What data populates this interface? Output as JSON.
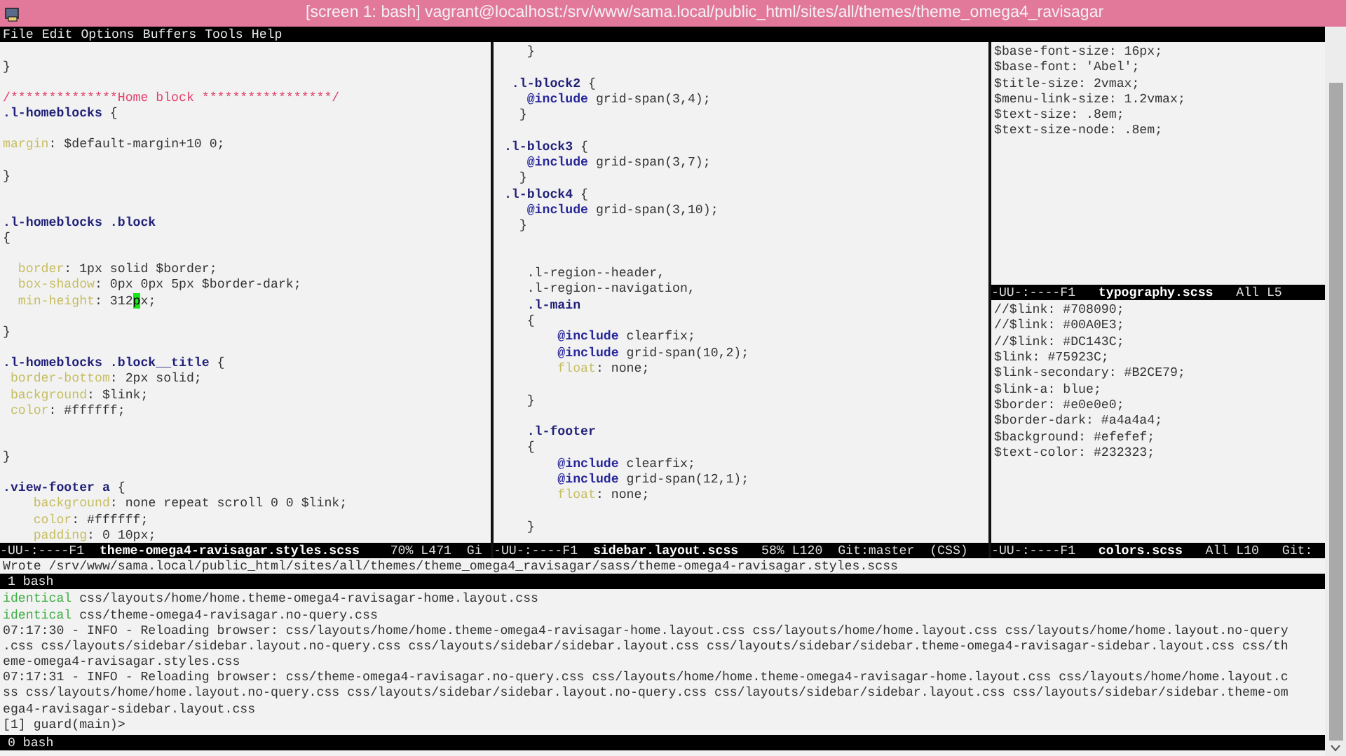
{
  "window": {
    "title": "[screen 1: bash] vagrant@localhost:/srv/www/sama.local/public_html/sites/all/themes/theme_omega4_ravisagar"
  },
  "menu": [
    "File",
    "Edit",
    "Options",
    "Buffers",
    "Tools",
    "Help"
  ],
  "panes": [
    {
      "windows": [
        {
          "lines": [
            {
              "kind": "blank"
            },
            {
              "kind": "code",
              "parts": [
                {
                  "text": "}",
                  "kind": "plain"
                }
              ]
            },
            {
              "kind": "blank"
            },
            {
              "kind": "code",
              "parts": [
                {
                  "text": "/**************Home block *****************/",
                  "kind": "comment"
                }
              ]
            },
            {
              "kind": "code",
              "parts": [
                {
                  "text": ".l-homeblocks",
                  "kind": "selector"
                },
                {
                  "text": " {",
                  "kind": "plain"
                }
              ]
            },
            {
              "kind": "blank"
            },
            {
              "kind": "code",
              "parts": [
                {
                  "text": "margin",
                  "kind": "property"
                },
                {
                  "text": ": $default-margin+10 0;",
                  "kind": "plain"
                }
              ]
            },
            {
              "kind": "blank"
            },
            {
              "kind": "code",
              "parts": [
                {
                  "text": "}",
                  "kind": "plain"
                }
              ]
            },
            {
              "kind": "blank"
            },
            {
              "kind": "blank"
            },
            {
              "kind": "code",
              "parts": [
                {
                  "text": ".l-homeblocks .block",
                  "kind": "selector"
                }
              ]
            },
            {
              "kind": "code",
              "parts": [
                {
                  "text": "{",
                  "kind": "plain"
                }
              ]
            },
            {
              "kind": "blank"
            },
            {
              "kind": "code",
              "parts": [
                {
                  "text": "  border",
                  "kind": "property"
                },
                {
                  "text": ": 1px solid $border;",
                  "kind": "plain"
                }
              ]
            },
            {
              "kind": "code",
              "parts": [
                {
                  "text": "  box-shadow",
                  "kind": "property"
                },
                {
                  "text": ": 0px 0px 5px $border-dark;",
                  "kind": "plain"
                }
              ]
            },
            {
              "kind": "code",
              "parts": [
                {
                  "text": "  min-height",
                  "kind": "property"
                },
                {
                  "text": ": 312",
                  "kind": "plain"
                },
                {
                  "text": "p",
                  "kind": "cursor"
                },
                {
                  "text": "x;",
                  "kind": "plain"
                }
              ]
            },
            {
              "kind": "blank"
            },
            {
              "kind": "code",
              "parts": [
                {
                  "text": "}",
                  "kind": "plain"
                }
              ]
            },
            {
              "kind": "blank"
            },
            {
              "kind": "code",
              "parts": [
                {
                  "text": ".l-homeblocks .block__title",
                  "kind": "selector"
                },
                {
                  "text": " {",
                  "kind": "plain"
                }
              ]
            },
            {
              "kind": "code",
              "parts": [
                {
                  "text": " border-bottom",
                  "kind": "property"
                },
                {
                  "text": ": 2px solid;",
                  "kind": "plain"
                }
              ]
            },
            {
              "kind": "code",
              "parts": [
                {
                  "text": " background",
                  "kind": "property"
                },
                {
                  "text": ": $link;",
                  "kind": "plain"
                }
              ]
            },
            {
              "kind": "code",
              "parts": [
                {
                  "text": " color",
                  "kind": "property"
                },
                {
                  "text": ": #ffffff;",
                  "kind": "plain"
                }
              ]
            },
            {
              "kind": "blank"
            },
            {
              "kind": "blank"
            },
            {
              "kind": "code",
              "parts": [
                {
                  "text": "}",
                  "kind": "plain"
                }
              ]
            },
            {
              "kind": "blank"
            },
            {
              "kind": "code",
              "parts": [
                {
                  "text": ".view-footer a",
                  "kind": "selector"
                },
                {
                  "text": " {",
                  "kind": "plain"
                }
              ]
            },
            {
              "kind": "code",
              "parts": [
                {
                  "text": "    background",
                  "kind": "property"
                },
                {
                  "text": ": none repeat scroll 0 0 $link;",
                  "kind": "plain"
                }
              ]
            },
            {
              "kind": "code",
              "parts": [
                {
                  "text": "    color",
                  "kind": "property"
                },
                {
                  "text": ": #ffffff;",
                  "kind": "plain"
                }
              ]
            },
            {
              "kind": "code",
              "parts": [
                {
                  "text": "    padding",
                  "kind": "property"
                },
                {
                  "text": ": 0 10px;",
                  "kind": "plain"
                }
              ]
            }
          ],
          "mode_line": [
            {
              "text": "-UU-:----F1  ",
              "kind": "plain"
            },
            {
              "text": "theme-omega4-ravisagar.styles.scss",
              "kind": "bold"
            },
            {
              "text": "    70% L471  Gi",
              "kind": "plain"
            }
          ]
        }
      ]
    },
    {
      "windows": [
        {
          "lines": [
            {
              "kind": "code",
              "parts": [
                {
                  "text": "    }",
                  "kind": "plain"
                }
              ]
            },
            {
              "kind": "blank"
            },
            {
              "kind": "code",
              "parts": [
                {
                  "text": "  .l-block2",
                  "kind": "selector"
                },
                {
                  "text": " {",
                  "kind": "plain"
                }
              ]
            },
            {
              "kind": "code",
              "parts": [
                {
                  "text": "    @include",
                  "kind": "keyword"
                },
                {
                  "text": " grid-span(3,4);",
                  "kind": "plain"
                }
              ]
            },
            {
              "kind": "code",
              "parts": [
                {
                  "text": "   }",
                  "kind": "plain"
                }
              ]
            },
            {
              "kind": "blank"
            },
            {
              "kind": "code",
              "parts": [
                {
                  "text": " .l-block3",
                  "kind": "selector"
                },
                {
                  "text": " {",
                  "kind": "plain"
                }
              ]
            },
            {
              "kind": "code",
              "parts": [
                {
                  "text": "    @include",
                  "kind": "keyword"
                },
                {
                  "text": " grid-span(3,7);",
                  "kind": "plain"
                }
              ]
            },
            {
              "kind": "code",
              "parts": [
                {
                  "text": "   }",
                  "kind": "plain"
                }
              ]
            },
            {
              "kind": "code",
              "parts": [
                {
                  "text": " .l-block4",
                  "kind": "selector"
                },
                {
                  "text": " {",
                  "kind": "plain"
                }
              ]
            },
            {
              "kind": "code",
              "parts": [
                {
                  "text": "    @include",
                  "kind": "keyword"
                },
                {
                  "text": " grid-span(3,10);",
                  "kind": "plain"
                }
              ]
            },
            {
              "kind": "code",
              "parts": [
                {
                  "text": "   }",
                  "kind": "plain"
                }
              ]
            },
            {
              "kind": "blank"
            },
            {
              "kind": "blank"
            },
            {
              "kind": "code",
              "parts": [
                {
                  "text": "    .l-region--header,",
                  "kind": "plain"
                }
              ]
            },
            {
              "kind": "code",
              "parts": [
                {
                  "text": "    .l-region--navigation,",
                  "kind": "plain"
                }
              ]
            },
            {
              "kind": "code",
              "parts": [
                {
                  "text": "    .l-main",
                  "kind": "selector"
                }
              ]
            },
            {
              "kind": "code",
              "parts": [
                {
                  "text": "    {",
                  "kind": "plain"
                }
              ]
            },
            {
              "kind": "code",
              "parts": [
                {
                  "text": "        @include",
                  "kind": "keyword"
                },
                {
                  "text": " clearfix;",
                  "kind": "plain"
                }
              ]
            },
            {
              "kind": "code",
              "parts": [
                {
                  "text": "        @include",
                  "kind": "keyword"
                },
                {
                  "text": " grid-span(10,2);",
                  "kind": "plain"
                }
              ]
            },
            {
              "kind": "code",
              "parts": [
                {
                  "text": "        float",
                  "kind": "property"
                },
                {
                  "text": ": none;",
                  "kind": "plain"
                }
              ]
            },
            {
              "kind": "blank"
            },
            {
              "kind": "code",
              "parts": [
                {
                  "text": "    }",
                  "kind": "plain"
                }
              ]
            },
            {
              "kind": "blank"
            },
            {
              "kind": "code",
              "parts": [
                {
                  "text": "    .l-footer",
                  "kind": "selector"
                }
              ]
            },
            {
              "kind": "code",
              "parts": [
                {
                  "text": "    {",
                  "kind": "plain"
                }
              ]
            },
            {
              "kind": "code",
              "parts": [
                {
                  "text": "        @include",
                  "kind": "keyword"
                },
                {
                  "text": " clearfix;",
                  "kind": "plain"
                }
              ]
            },
            {
              "kind": "code",
              "parts": [
                {
                  "text": "        @include",
                  "kind": "keyword"
                },
                {
                  "text": " grid-span(12,1);",
                  "kind": "plain"
                }
              ]
            },
            {
              "kind": "code",
              "parts": [
                {
                  "text": "        float",
                  "kind": "property"
                },
                {
                  "text": ": none;",
                  "kind": "plain"
                }
              ]
            },
            {
              "kind": "blank"
            },
            {
              "kind": "code",
              "parts": [
                {
                  "text": "    }",
                  "kind": "plain"
                }
              ]
            }
          ],
          "mode_line": [
            {
              "text": "-UU-:----F1  ",
              "kind": "plain"
            },
            {
              "text": "sidebar.layout.scss",
              "kind": "bold"
            },
            {
              "text": "   58% L120  Git:master  (CSS)",
              "kind": "plain"
            }
          ]
        }
      ]
    },
    {
      "windows": [
        {
          "lines": [
            {
              "kind": "code",
              "parts": [
                {
                  "text": "$base-font-size: 16px;",
                  "kind": "plain"
                }
              ]
            },
            {
              "kind": "code",
              "parts": [
                {
                  "text": "$base-font: 'Abel';",
                  "kind": "plain"
                }
              ]
            },
            {
              "kind": "code",
              "parts": [
                {
                  "text": "$title-size: 2vmax;",
                  "kind": "plain"
                }
              ]
            },
            {
              "kind": "code",
              "parts": [
                {
                  "text": "$menu-link-size: 1.2vmax;",
                  "kind": "plain"
                }
              ]
            },
            {
              "kind": "code",
              "parts": [
                {
                  "text": "$text-size: .8em;",
                  "kind": "plain"
                }
              ]
            },
            {
              "kind": "code",
              "parts": [
                {
                  "text": "$text-size-node: .8em;",
                  "kind": "plain"
                }
              ]
            }
          ],
          "mode_line": [
            {
              "text": "-UU-:----F1   ",
              "kind": "plain"
            },
            {
              "text": "typography.scss",
              "kind": "bold"
            },
            {
              "text": "   All L5",
              "kind": "plain"
            }
          ]
        },
        {
          "lines": [
            {
              "kind": "code",
              "parts": [
                {
                  "text": "//$link: #708090;",
                  "kind": "plain"
                }
              ]
            },
            {
              "kind": "code",
              "parts": [
                {
                  "text": "//$link: #00A0E3;",
                  "kind": "plain"
                }
              ]
            },
            {
              "kind": "code",
              "parts": [
                {
                  "text": "//$link: #DC143C;",
                  "kind": "plain"
                }
              ]
            },
            {
              "kind": "code",
              "parts": [
                {
                  "text": "$link: #75923C;",
                  "kind": "plain"
                }
              ]
            },
            {
              "kind": "code",
              "parts": [
                {
                  "text": "$link-secondary: #B2CE79;",
                  "kind": "plain"
                }
              ]
            },
            {
              "kind": "code",
              "parts": [
                {
                  "text": "$link-a: blue;",
                  "kind": "plain"
                }
              ]
            },
            {
              "kind": "code",
              "parts": [
                {
                  "text": "$border: #e0e0e0;",
                  "kind": "plain"
                }
              ]
            },
            {
              "kind": "code",
              "parts": [
                {
                  "text": "$border-dark: #a4a4a4;",
                  "kind": "plain"
                }
              ]
            },
            {
              "kind": "code",
              "parts": [
                {
                  "text": "$background: #efefef;",
                  "kind": "plain"
                }
              ]
            },
            {
              "kind": "code",
              "parts": [
                {
                  "text": "$text-color: #232323;",
                  "kind": "plain"
                }
              ]
            }
          ],
          "mode_line": [
            {
              "text": "-UU-:----F1   ",
              "kind": "plain"
            },
            {
              "text": "colors.scss",
              "kind": "bold"
            },
            {
              "text": "   All L10   Git:",
              "kind": "plain"
            }
          ]
        }
      ]
    }
  ],
  "echo_line": "Wrote /srv/www/sama.local/public_html/sites/all/themes/theme_omega4_ravisagar/sass/theme-omega4-ravisagar.styles.scss",
  "screen_tab_top": " 1 bash",
  "shell_output": [
    {
      "parts": [
        {
          "text": "identical",
          "kind": "status"
        },
        {
          "text": " css/layouts/home/home.theme-omega4-ravisagar-home.layout.css",
          "kind": "plain"
        }
      ]
    },
    {
      "parts": [
        {
          "text": "identical",
          "kind": "status"
        },
        {
          "text": " css/theme-omega4-ravisagar.no-query.css",
          "kind": "plain"
        }
      ]
    },
    {
      "parts": [
        {
          "text": "07:17:30 - INFO - Reloading browser: css/layouts/home/home.theme-omega4-ravisagar-home.layout.css css/layouts/home/home.layout.css css/layouts/home/home.layout.no-query",
          "kind": "plain"
        }
      ]
    },
    {
      "parts": [
        {
          "text": ".css css/layouts/sidebar/sidebar.layout.no-query.css css/layouts/sidebar/sidebar.layout.css css/layouts/sidebar/sidebar.theme-omega4-ravisagar-sidebar.layout.css css/th",
          "kind": "plain"
        }
      ]
    },
    {
      "parts": [
        {
          "text": "eme-omega4-ravisagar.styles.css",
          "kind": "plain"
        }
      ]
    },
    {
      "parts": [
        {
          "text": "07:17:31 - INFO - Reloading browser: css/theme-omega4-ravisagar.no-query.css css/layouts/home/home.theme-omega4-ravisagar-home.layout.css css/layouts/home/home.layout.c",
          "kind": "plain"
        }
      ]
    },
    {
      "parts": [
        {
          "text": "ss css/layouts/home/home.layout.no-query.css css/layouts/sidebar/sidebar.layout.no-query.css css/layouts/sidebar/sidebar.layout.css css/layouts/sidebar/sidebar.theme-om",
          "kind": "plain"
        }
      ]
    },
    {
      "parts": [
        {
          "text": "ega4-ravisagar-sidebar.layout.css",
          "kind": "plain"
        }
      ]
    },
    {
      "parts": [
        {
          "text": "[1] guard(main)>",
          "kind": "plain"
        }
      ]
    }
  ],
  "screen_tab_bottom": " 0 bash"
}
